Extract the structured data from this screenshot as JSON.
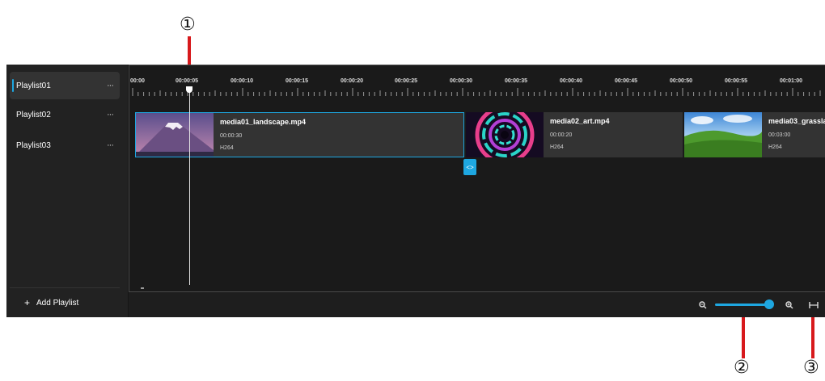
{
  "callouts": [
    "①",
    "②",
    "③"
  ],
  "sidebar": {
    "playlists": [
      {
        "label": "Playlist01",
        "more": "···",
        "selected": true
      },
      {
        "label": "Playlist02",
        "more": "···",
        "selected": false
      },
      {
        "label": "Playlist03",
        "more": "···",
        "selected": false
      }
    ],
    "add_playlist_icon": "+",
    "add_playlist_label": "Add Playlist"
  },
  "ruler": {
    "labels": [
      "00:00",
      "00:00:05",
      "00:00:10",
      "00:00:15",
      "00:00:20",
      "00:00:25",
      "00:00:30",
      "00:00:35",
      "00:00:40",
      "00:00:45",
      "00:00:50",
      "00:00:55",
      "00:01:00"
    ]
  },
  "clips": [
    {
      "name": "media01_landscape.mp4",
      "duration": "00:00:30",
      "codec": "H264",
      "selected": true,
      "thumbnail": "mountain"
    },
    {
      "name": "media02_art.mp4",
      "duration": "00:00:20",
      "codec": "H264",
      "selected": false,
      "thumbnail": "rings"
    },
    {
      "name": "media03_grassla",
      "duration": "00:03:00",
      "codec": "H264",
      "selected": false,
      "thumbnail": "grassland"
    }
  ],
  "transition_handle_icon": "<>",
  "zoom": {
    "level": 0.9
  },
  "colors": {
    "accent": "#1ea7e1",
    "background": "#1b1b1b",
    "clip": "#333333",
    "callout": "#d7191c"
  },
  "icons": {
    "zoom_out": "zoom-out-icon",
    "zoom_in": "zoom-in-icon",
    "fit": "fit-to-width-icon"
  }
}
